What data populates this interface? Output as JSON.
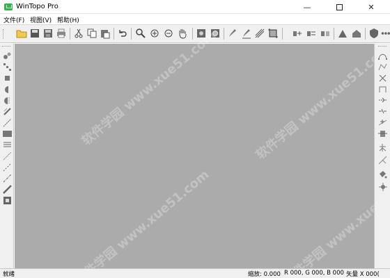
{
  "window": {
    "title": "WinTopo Pro",
    "minimize_glyph": "—",
    "close_glyph": "✕"
  },
  "menu": [
    "文件(F)",
    "视图(V)",
    "帮助(H)"
  ],
  "toolbar": {
    "icons": [
      "open-folder-icon",
      "save-icon",
      "save-as-icon",
      "print-icon",
      "cut-icon",
      "copy-icon",
      "paste-icon",
      "undo-icon",
      "zoom-icon",
      "zoom-in-icon",
      "zoom-out-icon",
      "pan-hand-icon",
      "image-icon",
      "image-settings-icon",
      "pencil-icon",
      "line-pencil-icon",
      "hatch-icon",
      "crop-icon",
      "vectorize-icon",
      "vectorize-alt-icon",
      "vectorize-fill-icon",
      "shape-icon",
      "shape-alt-icon",
      "shield-icon",
      "scatter-icon"
    ]
  },
  "left_tools": {
    "icons": [
      "points-icon",
      "nodes-icon",
      "square-icon",
      "half-circle-icon",
      "dashed-half-icon",
      "diagonal-icon",
      "dashed-diagonal-icon",
      "rectangle-icon",
      "lines-icon",
      "dotted-line-icon",
      "dashed-line-icon",
      "dash-dot-line-icon",
      "thick-line-icon",
      "frame-icon"
    ]
  },
  "right_tools": {
    "icons": [
      "curve-icon",
      "polyline-icon",
      "cross-icon",
      "bracket-icon",
      "join-icon",
      "break-icon",
      "insert-node-icon",
      "node-square-icon",
      "split-icon",
      "branch-icon",
      "fill-bucket-icon",
      "settings-icon"
    ]
  },
  "watermark": "软件学园 www.xue51.com",
  "status": {
    "left": "就绪",
    "zoom": "缩放: 0.000",
    "color": "R 000, G 000, B 000",
    "vector": "矢量 X 000("
  },
  "colors": {
    "canvas": "#ababab",
    "chrome": "#f0f0f0",
    "app_icon": "#2fb84a"
  }
}
